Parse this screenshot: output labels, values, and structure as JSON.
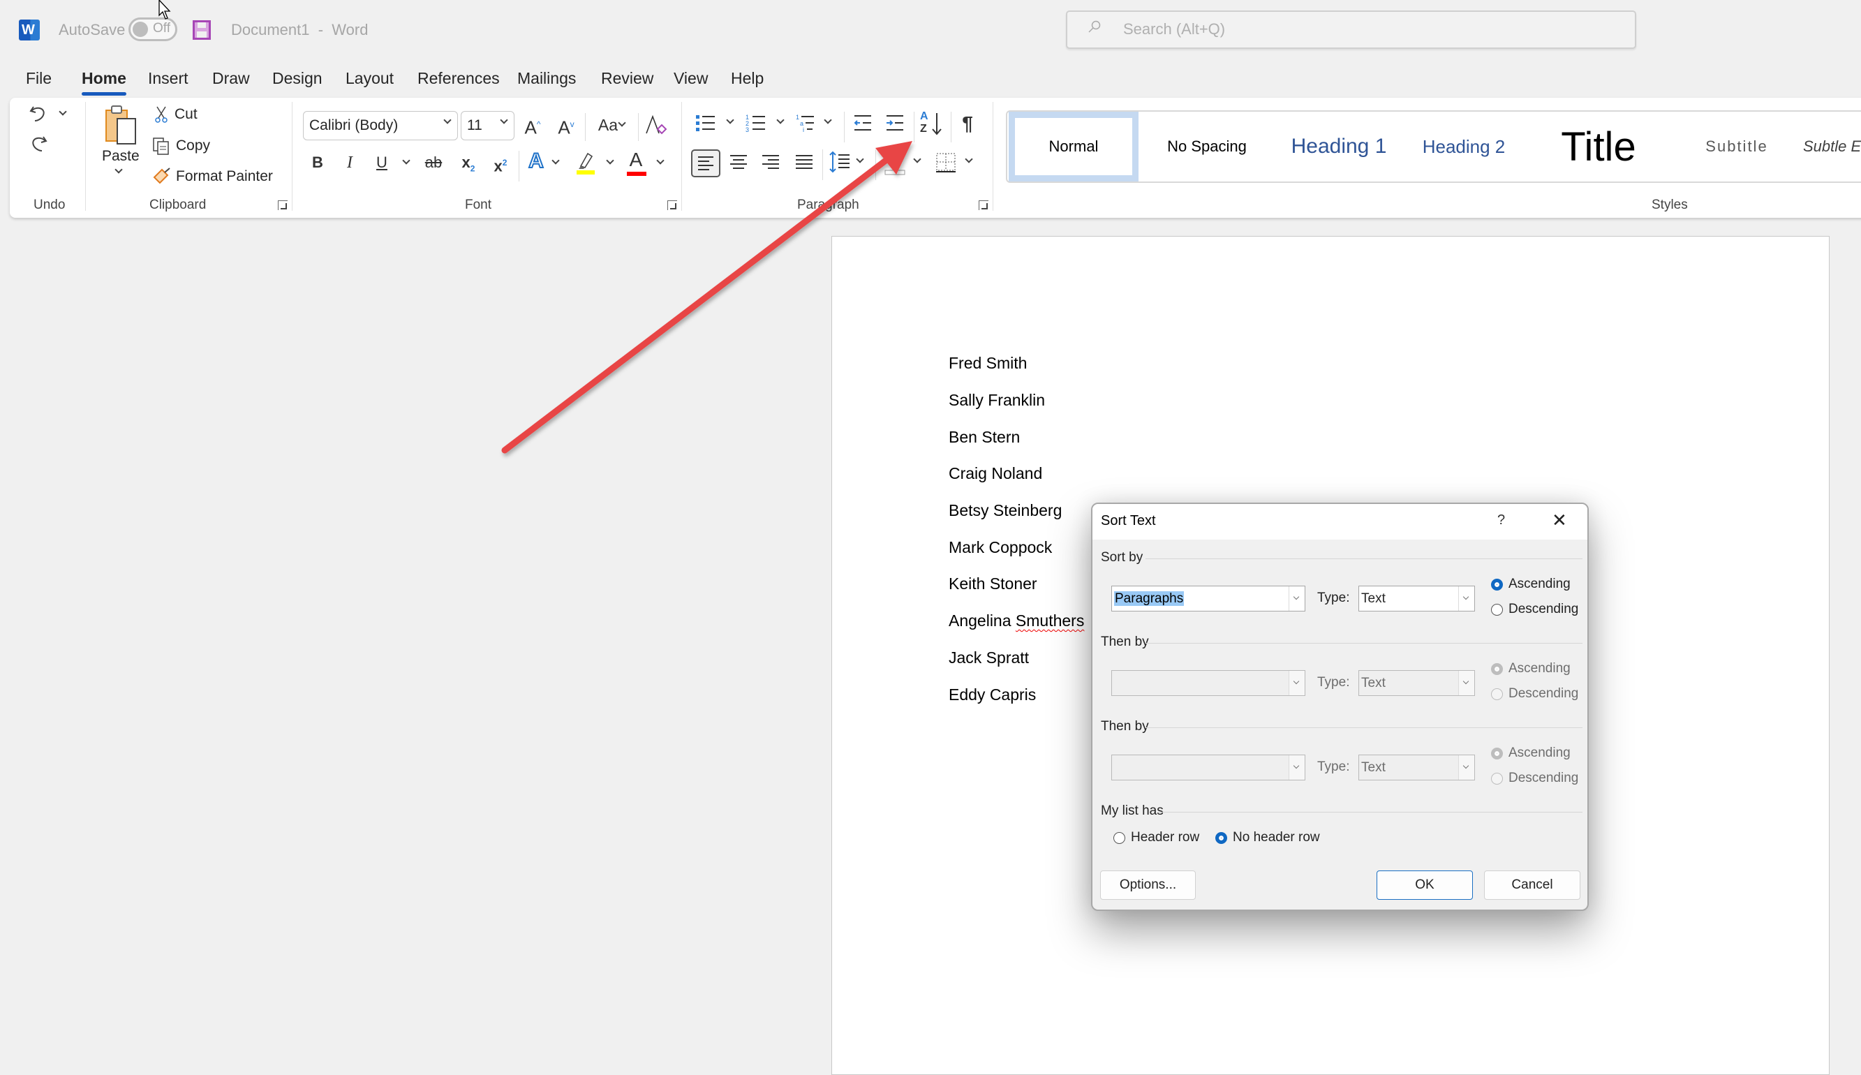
{
  "titlebar": {
    "app_icon": "word-logo-icon",
    "app_icon_letter": "W",
    "autosave_label": "AutoSave",
    "autosave_state": "Off",
    "save_icon": "save-icon",
    "document_title": "Document1  -  Word",
    "search_placeholder": "Search (Alt+Q)"
  },
  "tabs": [
    {
      "label": "File"
    },
    {
      "label": "Home",
      "active": true
    },
    {
      "label": "Insert"
    },
    {
      "label": "Draw"
    },
    {
      "label": "Design"
    },
    {
      "label": "Layout"
    },
    {
      "label": "References"
    },
    {
      "label": "Mailings"
    },
    {
      "label": "Review"
    },
    {
      "label": "View"
    },
    {
      "label": "Help"
    }
  ],
  "ribbon": {
    "undo": {
      "group_label": "Undo"
    },
    "clipboard": {
      "group_label": "Clipboard",
      "paste": "Paste",
      "cut": "Cut",
      "copy": "Copy",
      "format_painter": "Format Painter"
    },
    "font": {
      "group_label": "Font",
      "font_name": "Calibri (Body)",
      "font_size": "11",
      "change_case": "Aa",
      "bold": "B",
      "italic": "I",
      "underline": "U",
      "strikethrough": "ab",
      "subscript": "x",
      "superscript": "x",
      "text_effects": "A",
      "font_color": "A",
      "highlight_color": "#ffff00",
      "font_color_value": "#ff0000"
    },
    "paragraph": {
      "group_label": "Paragraph",
      "sort_icon_top": "A",
      "sort_icon_bottom": "Z",
      "show_marks": "¶"
    },
    "styles": {
      "group_label": "Styles",
      "items": [
        {
          "label": "Normal",
          "selected": true
        },
        {
          "label": "No Spacing"
        },
        {
          "label": "Heading 1"
        },
        {
          "label": "Heading 2"
        },
        {
          "label": "Title"
        },
        {
          "label": "Subtitle"
        },
        {
          "label": "Subtle E"
        }
      ]
    }
  },
  "document": {
    "lines": [
      "Fred Smith",
      "Sally Franklin",
      "Ben Stern",
      "Craig Noland",
      "Betsy Steinberg",
      "Mark Coppock",
      "Keith Stoner",
      "Angelina Smuthers",
      "Jack Spratt",
      "Eddy Capris"
    ],
    "misspelled_word": "Smuthers"
  },
  "dialog": {
    "title": "Sort Text",
    "help": "?",
    "close": "✕",
    "sort_by": {
      "label": "Sort by",
      "field": "Paragraphs",
      "type_label": "Type:",
      "type": "Text",
      "ascending": "Ascending",
      "descending": "Descending",
      "order": "ascending"
    },
    "then_by_1": {
      "label": "Then by",
      "field": "",
      "type_label": "Type:",
      "type": "Text",
      "ascending": "Ascending",
      "descending": "Descending",
      "order": "ascending",
      "disabled": true
    },
    "then_by_2": {
      "label": "Then by",
      "field": "",
      "type_label": "Type:",
      "type": "Text",
      "ascending": "Ascending",
      "descending": "Descending",
      "order": "ascending",
      "disabled": true
    },
    "my_list_has": {
      "label": "My list has",
      "header_row": "Header row",
      "no_header_row": "No header row",
      "selected": "no_header_row"
    },
    "buttons": {
      "options": "Options...",
      "ok": "OK",
      "cancel": "Cancel"
    }
  },
  "annotation": {
    "type": "arrow",
    "color": "#e84545",
    "points_to": "sort-button"
  }
}
